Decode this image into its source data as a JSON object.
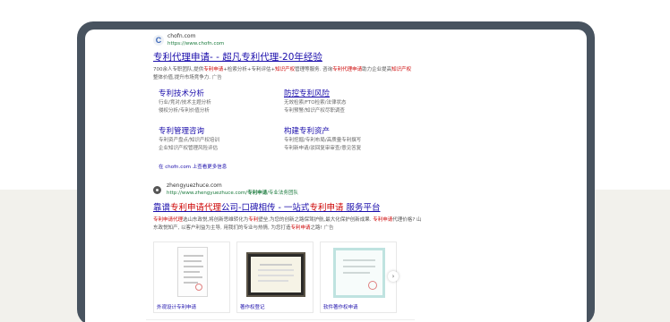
{
  "result1": {
    "site_name": "chofn.com",
    "site_url": "https://www.chofn.com",
    "title_main": "专利代理申请- - 超凡专利代理-20年经验",
    "desc_parts": [
      "700余人专职团队,提供",
      "专利申请",
      "+检索分析+专利评估+",
      "知识产权",
      "管理等服务. 咨询",
      "专利代理申请",
      "助力企业提高",
      "知识产权",
      "整体价值,提升市场竞争力. "
    ],
    "ad_label": "广告",
    "sitelinks": [
      {
        "title": "专利技术分析",
        "lines": [
          "行业/竞对/技术主题分析",
          "侵权分析/专利价值分析"
        ]
      },
      {
        "title": "防控专利风险",
        "lines": [
          "无效检索/FTO检索/法律状态",
          "专利预警/知识产权尽职调查"
        ]
      },
      {
        "title": "专利管理咨询",
        "lines": [
          "专利资产盘点/知识产权培训",
          "企业知识产权管理风险评估"
        ]
      },
      {
        "title": "构建专利资产",
        "lines": [
          "专利挖掘/专利布局/高质量专利撰写",
          "专利新申请/驳回复审审查/意见答复"
        ]
      }
    ],
    "more_link": "在 chofn.com 上查看更多信息"
  },
  "result2": {
    "site_name": "zhengyuezhuce.com",
    "site_url_plain": "http://www.zhengyuezhuce.com/",
    "site_url_bold": "专利申请",
    "site_url_tail": "/专业法务团队",
    "title_a": "靠谱",
    "title_b": "专利申请代理",
    "title_c": "公司-口碑相传 - 一站式",
    "title_d": "专利申请",
    "title_e": " 服务平台",
    "desc_parts": [
      "专利申请代理",
      "选山东政悦,将创新思维转化为",
      "专利",
      "壁垒,为您的创新之路保驾护航,最大化保护创新成果. ",
      "专利申请",
      "代理价格",
      "? 山东政悦知产, 以客户利益为主导, 用我们的专业与热情, 为您打造",
      "专利申请",
      "之路! "
    ],
    "ad_label": "广告",
    "thumbnails": [
      {
        "label": "外观设计专利申请"
      },
      {
        "label": "著作权登记"
      },
      {
        "label": "软件著作权申请"
      }
    ],
    "next_glyph": "›"
  }
}
